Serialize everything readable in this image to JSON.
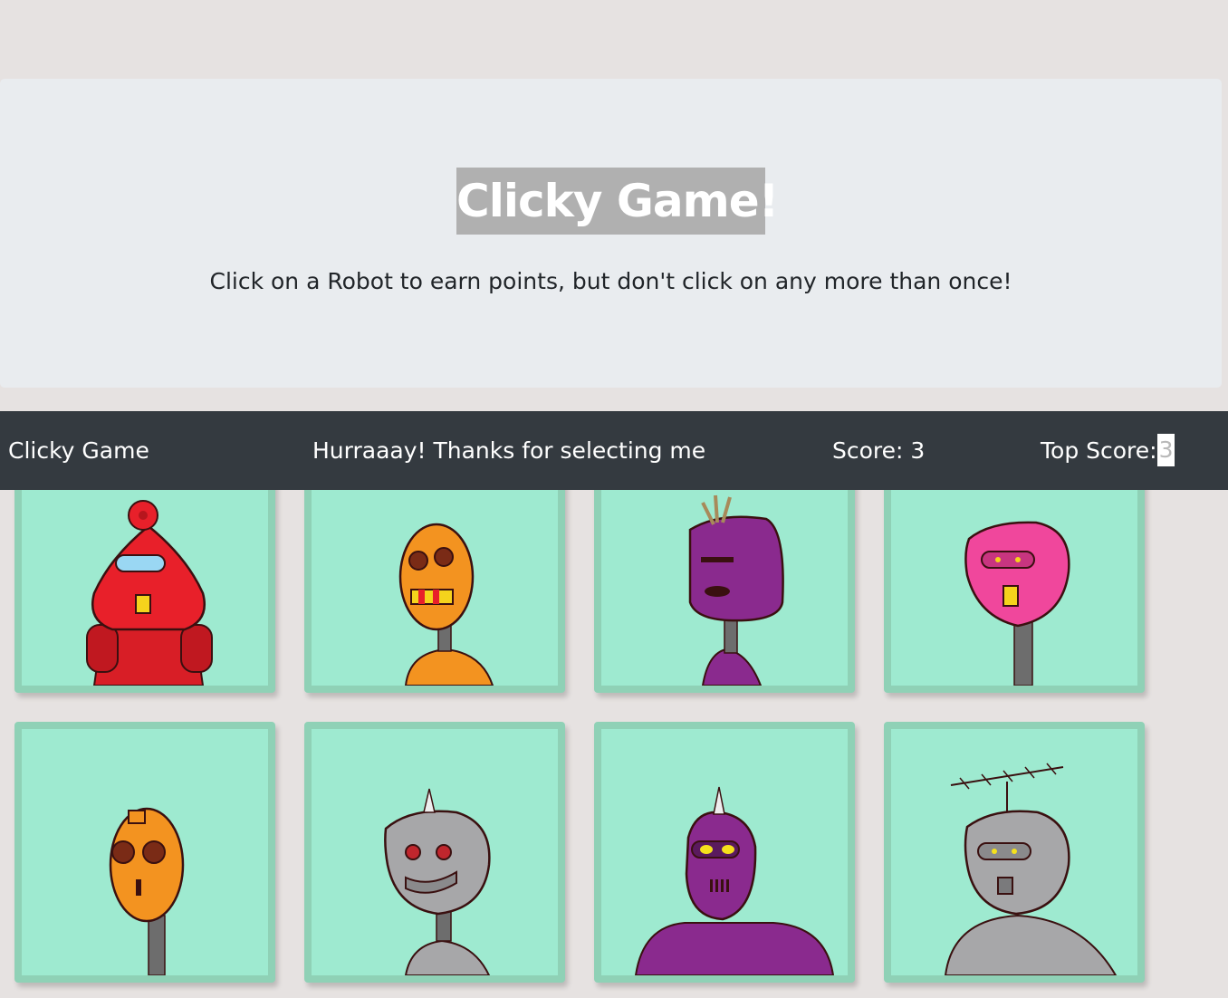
{
  "header": {
    "title": "Clicky Game!",
    "subtitle": "Click on a Robot to earn points, but don't click on any more than once!"
  },
  "navbar": {
    "brand": "Clicky Game",
    "message": "Hurraaay! Thanks for selecting me",
    "score_label": "Score: 3",
    "top_score_label": "Top Score:",
    "top_score_value": "3"
  },
  "colors": {
    "background": "#e6e2e1",
    "jumbotron": "#e9ecef",
    "navbar": "#343a40",
    "card_fill": "#9eead0",
    "card_border": "#8fd1b6"
  },
  "robots": [
    {
      "name": "red-robot-icon",
      "color": "#e8202a"
    },
    {
      "name": "orange-robot-icon",
      "color": "#f39320"
    },
    {
      "name": "purple-robot-icon",
      "color": "#8a2a8e"
    },
    {
      "name": "pink-robot-icon",
      "color": "#f0479c"
    },
    {
      "name": "orange-small-robot-icon",
      "color": "#f39320"
    },
    {
      "name": "gray-robot-icon",
      "color": "#a7a7a9"
    },
    {
      "name": "purple-big-robot-icon",
      "color": "#8a2a8e"
    },
    {
      "name": "gray-antenna-robot-icon",
      "color": "#a7a7a9"
    }
  ]
}
